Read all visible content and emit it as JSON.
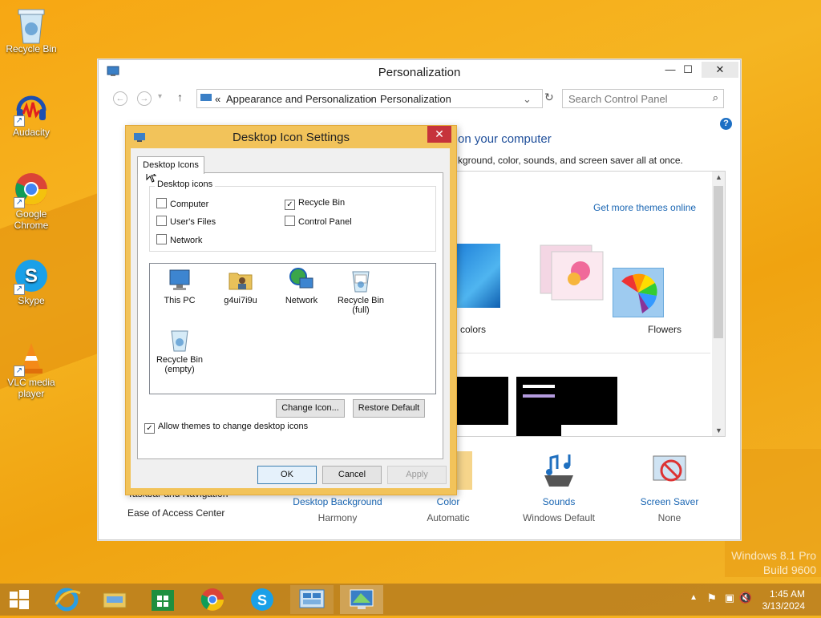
{
  "desktop": {
    "icons": [
      {
        "label": "Recycle Bin",
        "icon": "recycle-bin-icon"
      },
      {
        "label": "Audacity",
        "icon": "audacity-icon"
      },
      {
        "label": "Google Chrome",
        "icon": "chrome-icon"
      },
      {
        "label": "Skype",
        "icon": "skype-icon"
      },
      {
        "label": "VLC media player",
        "icon": "vlc-icon"
      }
    ],
    "watermark_line1": "Windows 8.1 Pro",
    "watermark_line2": "Build 9600"
  },
  "personalization": {
    "title": "Personalization",
    "minimize": "—",
    "maximize": "☐",
    "close": "✕",
    "breadcrumb_prefix": "«",
    "breadcrumb": [
      "Appearance and Personalization",
      "Personalization"
    ],
    "search_placeholder": "Search Control Panel",
    "headline": "on your computer",
    "subline": "kground, color, sounds, and screen saver all at once.",
    "get_more_themes": "Get more themes online",
    "theme_labels": [
      "d colors",
      "Flowers"
    ],
    "left_links": [
      "Taskbar and Navigation",
      "Ease of Access Center"
    ],
    "bottom_items": [
      {
        "label": "Desktop Background",
        "sub": "Harmony"
      },
      {
        "label": "Color",
        "sub": "Automatic"
      },
      {
        "label": "Sounds",
        "sub": "Windows Default"
      },
      {
        "label": "Screen Saver",
        "sub": "None"
      }
    ],
    "help": "?"
  },
  "dialog": {
    "title": "Desktop Icon Settings",
    "close": "✕",
    "tab": "Desktop Icons",
    "group_label": "Desktop icons",
    "checkboxes": [
      {
        "label": "Computer",
        "checked": false
      },
      {
        "label": "Recycle Bin",
        "checked": true
      },
      {
        "label": "User's Files",
        "checked": false
      },
      {
        "label": "Control Panel",
        "checked": false
      },
      {
        "label": "Network",
        "checked": false
      }
    ],
    "icons": [
      {
        "label": "This PC"
      },
      {
        "label": "g4ui7i9u"
      },
      {
        "label": "Network"
      },
      {
        "label": "Recycle Bin (full)"
      },
      {
        "label": "Recycle Bin (empty)"
      }
    ],
    "change_icon": "Change Icon...",
    "restore_default": "Restore Default",
    "allow_themes": "Allow themes to change desktop icons",
    "allow_themes_checked": true,
    "ok": "OK",
    "cancel": "Cancel",
    "apply": "Apply"
  },
  "taskbar": {
    "items": [
      "start-button",
      "internet-explorer",
      "file-explorer",
      "store",
      "chrome",
      "skype",
      "control-panel",
      "personalization"
    ],
    "time": "1:45 AM",
    "date": "3/13/2024"
  }
}
